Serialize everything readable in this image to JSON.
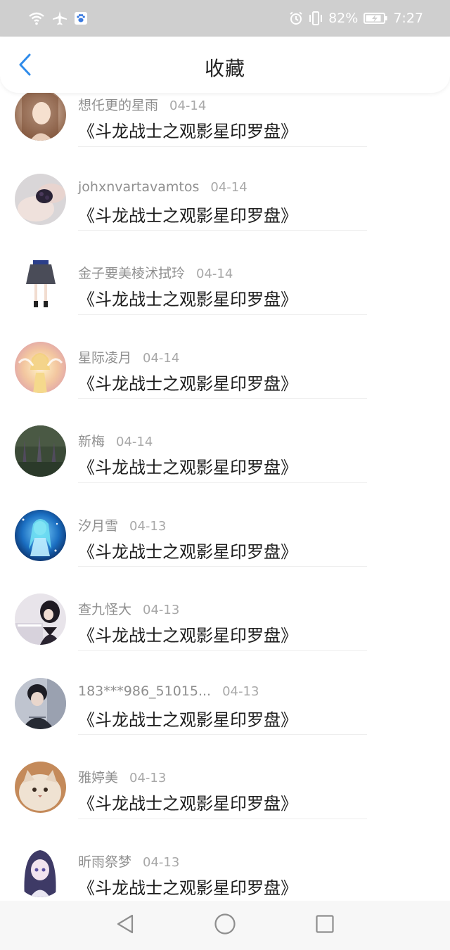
{
  "status_bar": {
    "battery_percent": "82%",
    "time": "7:27",
    "icons": [
      "wifi-icon",
      "airplane-icon",
      "paw-app-icon",
      "alarm-icon",
      "vibrate-icon",
      "battery-icon"
    ]
  },
  "header": {
    "title": "收藏",
    "back_icon": "chevron-left-icon",
    "accent_color": "#2f8bea"
  },
  "items": [
    {
      "name": "想仛更的星雨",
      "date": "04-14",
      "title": "《斗龙战士之观影星印罗盘》",
      "avatar": "avatar-illustrated-girl"
    },
    {
      "name": "johxnvartavamtos",
      "date": "04-14",
      "title": "《斗龙战士之观影星印罗盘》",
      "avatar": "avatar-hands-berries"
    },
    {
      "name": "金子要美棱沭拭玲",
      "date": "04-14",
      "title": "《斗龙战士之观影星印罗盘》",
      "avatar": "avatar-skirt-figure"
    },
    {
      "name": "星际凌月",
      "date": "04-14",
      "title": "《斗龙战士之观影星印罗盘》",
      "avatar": "avatar-glowing-angel"
    },
    {
      "name": "新梅",
      "date": "04-14",
      "title": "《斗龙战士之观影星印罗盘》",
      "avatar": "avatar-dark-forest"
    },
    {
      "name": "汐月雪",
      "date": "04-13",
      "title": "《斗龙战士之观影星印罗盘》",
      "avatar": "avatar-blue-anime"
    },
    {
      "name": "查九怪大",
      "date": "04-13",
      "title": "《斗龙战士之观影星印罗盘》",
      "avatar": "avatar-girl-piano"
    },
    {
      "name": "183***986_51015...",
      "date": "04-13",
      "title": "《斗龙战士之观影星印罗盘》",
      "avatar": "avatar-dark-boy"
    },
    {
      "name": "雅婷美",
      "date": "04-13",
      "title": "《斗龙战士之观影星印罗盘》",
      "avatar": "avatar-fluffy-cat"
    },
    {
      "name": "昕雨祭梦",
      "date": "04-13",
      "title": "《斗龙战士之观影星印罗盘》",
      "avatar": "avatar-purple-anime"
    }
  ],
  "nav_bar": {
    "icons": [
      "back-triangle-icon",
      "home-circle-icon",
      "recent-square-icon"
    ]
  }
}
